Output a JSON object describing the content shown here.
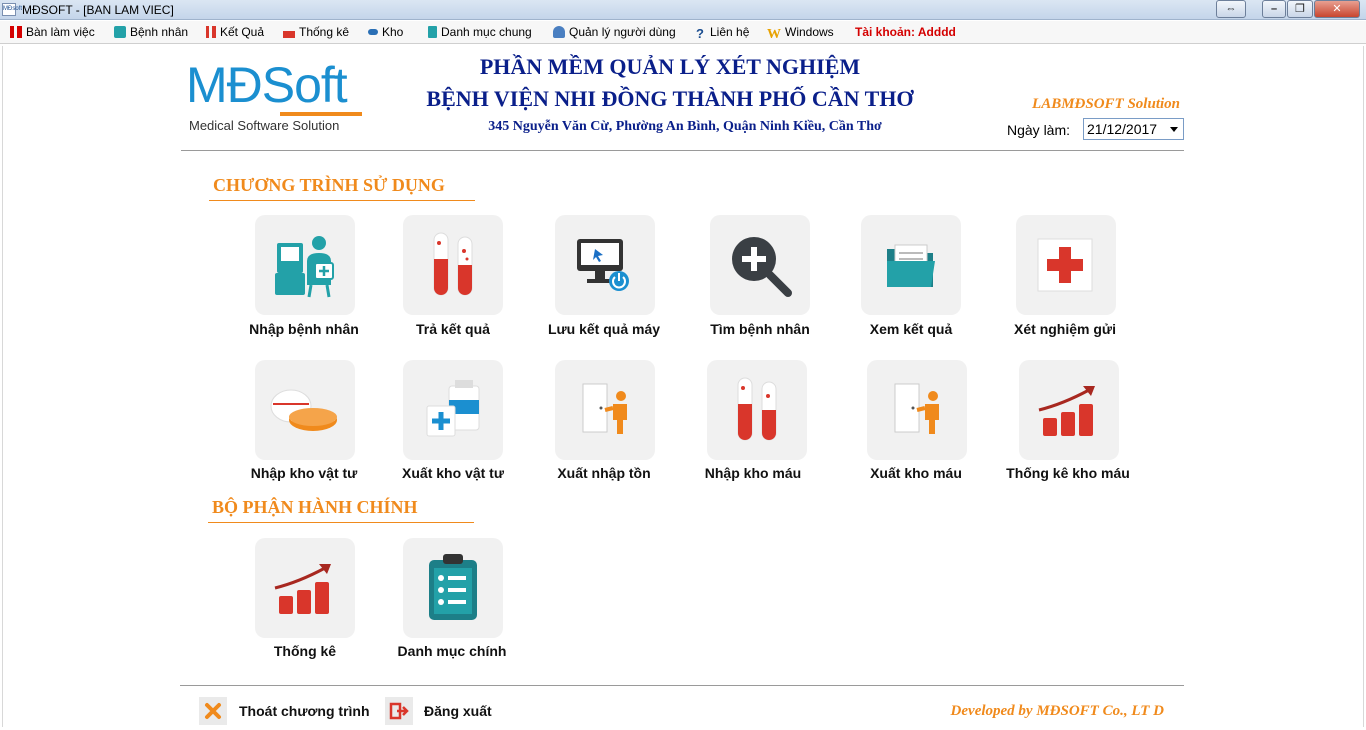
{
  "window": {
    "title": "MĐSOFT - [BAN LAM VIEC]",
    "icon_text": "MĐsoft"
  },
  "menu": [
    {
      "label": "Bàn làm việc",
      "icon": "desk-icon"
    },
    {
      "label": "Bệnh nhân",
      "icon": "patient-icon"
    },
    {
      "label": "Kết Quả",
      "icon": "result-icon"
    },
    {
      "label": "Thống kê",
      "icon": "stats-icon"
    },
    {
      "label": "Kho",
      "icon": "warehouse-icon"
    },
    {
      "label": "Danh mục chung",
      "icon": "catalog-icon"
    },
    {
      "label": "Quản lý người dùng",
      "icon": "users-icon"
    },
    {
      "label": "Liên hệ",
      "icon": "help-icon"
    },
    {
      "label": "Windows",
      "icon": "windows-icon"
    },
    {
      "label": "Tài khoản: Adddd",
      "icon": ""
    }
  ],
  "header": {
    "logo_text": "MĐSoft",
    "logo_sub": "Medical Software Solution",
    "title1": "PHẦN MỀM QUẢN LÝ XÉT NGHIỆM",
    "title2": "BỆNH VIỆN NHI ĐỒNG THÀNH PHỐ CẦN THƠ",
    "address": "345 Nguyễn Văn Cừ, Phường An Bình, Quận Ninh Kiều, Cần Thơ",
    "solution": "LABMĐSOFT Solution",
    "date_label": "Ngày làm:",
    "date_value": "21/12/2017"
  },
  "sections": {
    "programs": "CHƯƠNG TRÌNH SỬ DỤNG",
    "admin": "BỘ PHẬN HÀNH CHÍNH"
  },
  "tiles": [
    {
      "label": "Nhập bệnh nhân",
      "icon": "patient-entry-icon"
    },
    {
      "label": "Trả kết quả",
      "icon": "test-tubes-icon"
    },
    {
      "label": "Lưu kết quả máy",
      "icon": "computer-save-icon"
    },
    {
      "label": "Tìm bệnh nhân",
      "icon": "search-plus-icon"
    },
    {
      "label": "Xem kết quả",
      "icon": "folder-icon"
    },
    {
      "label": "Xét nghiệm gửi",
      "icon": "red-cross-icon"
    },
    {
      "label": "Nhập kho vật tư",
      "icon": "pills-icon"
    },
    {
      "label": "Xuất kho vật tư",
      "icon": "medicine-box-icon"
    },
    {
      "label": "Xuất nhập tồn",
      "icon": "door-person-icon"
    },
    {
      "label": "Nhập kho máu",
      "icon": "blood-tubes-icon"
    },
    {
      "label": "Xuất kho máu",
      "icon": "door-person-icon"
    },
    {
      "label": "Thống kê kho máu",
      "icon": "bar-chart-icon"
    },
    {
      "label": "Thống kê",
      "icon": "bar-chart-icon"
    },
    {
      "label": "Danh mục chính",
      "icon": "clipboard-icon"
    }
  ],
  "footer": {
    "exit": "Thoát chương trình",
    "logout": "Đăng xuất",
    "developer": "Developed by MĐSOFT  Co., LT D"
  },
  "colors": {
    "accent": "#f08a1c",
    "title": "#0a1f8a",
    "teal": "#23a1a8",
    "red": "#d9362b"
  }
}
